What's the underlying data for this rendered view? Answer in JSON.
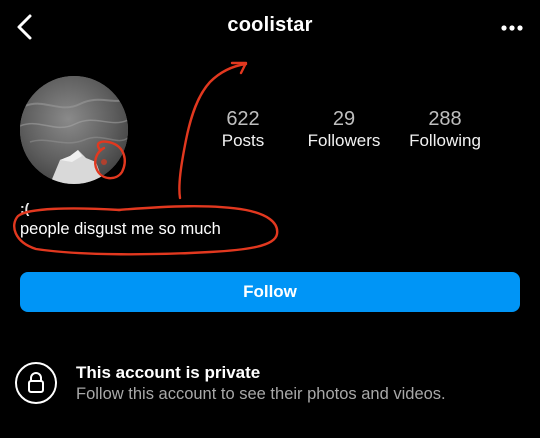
{
  "header": {
    "username": "coolistar",
    "back_icon": "chevron-left-icon",
    "more_icon": "more-horizontal-icon"
  },
  "profile": {
    "stats": [
      {
        "value": "622",
        "label": "Posts"
      },
      {
        "value": "29",
        "label": "Followers"
      },
      {
        "value": "288",
        "label": "Following"
      }
    ],
    "display_name": ":(",
    "bio": "people disgust me so much"
  },
  "actions": {
    "follow_label": "Follow",
    "follow_color": "#0095f6"
  },
  "private_notice": {
    "icon": "lock-icon",
    "title": "This account is private",
    "subtitle": "Follow this account to see their photos and videos."
  },
  "annotation_color": "#e2381f"
}
